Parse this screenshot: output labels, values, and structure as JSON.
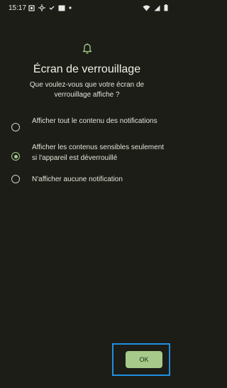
{
  "status_bar": {
    "time": "15:17",
    "left_icons": [
      "screenshot-icon",
      "settings-icon",
      "check-icon",
      "media-icon",
      "dot-icon"
    ],
    "right_icons": [
      "wifi-icon",
      "signal-icon",
      "battery-icon"
    ]
  },
  "header": {
    "icon": "bell-icon",
    "title": "Écran de verrouillage",
    "subtitle": "Que voulez-vous que votre écran de verrouillage affiche ?"
  },
  "options": [
    {
      "label": "Afficher tout le contenu des notifications",
      "selected": false
    },
    {
      "label": "Afficher les contenus sensibles seulement si l'appareil est déverrouillé",
      "selected": true
    },
    {
      "label": "N'afficher aucune notification",
      "selected": false
    }
  ],
  "actions": {
    "ok_label": "OK"
  },
  "colors": {
    "background": "#1c1d17",
    "accent": "#a7c98a",
    "focus_outline": "#1f8fe0"
  }
}
